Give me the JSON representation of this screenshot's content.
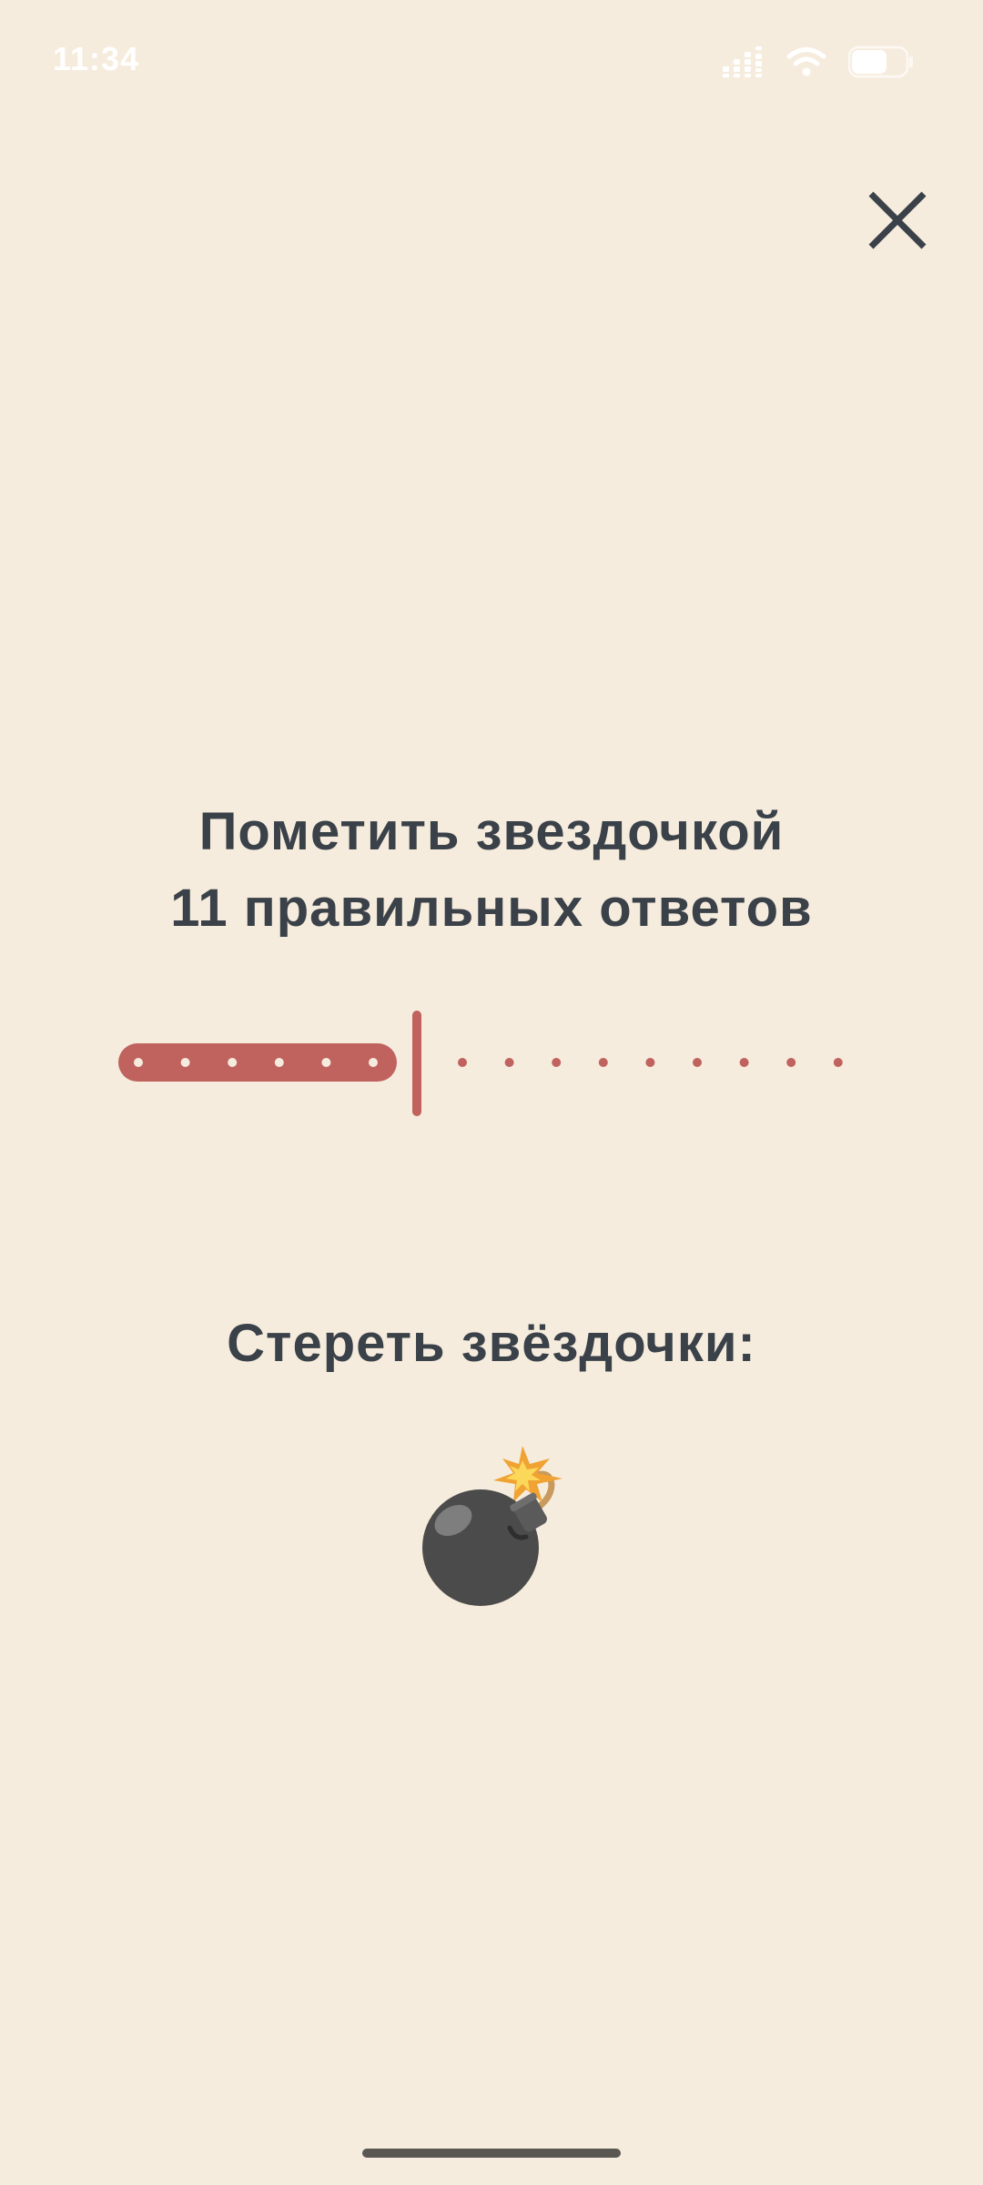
{
  "status_bar": {
    "time": "11:34",
    "icons": [
      "signal-icon",
      "wifi-icon",
      "battery-icon"
    ]
  },
  "close_button": {
    "icon": "close-icon"
  },
  "mark_section": {
    "title_line1": "Пометить звездочкой",
    "title_line2": "11 правильных ответов"
  },
  "slider": {
    "total_steps": 16,
    "selected_steps": 6,
    "accent_color": "#C0625E"
  },
  "erase_section": {
    "label": "Стереть звёздочки:",
    "icon": "bomb-icon"
  },
  "colors": {
    "background": "#F6ECDD",
    "text": "#3A4149",
    "accent": "#C0625E"
  }
}
